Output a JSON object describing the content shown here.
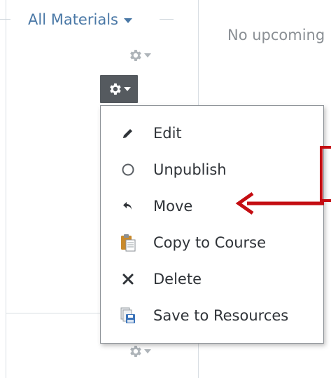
{
  "filter": {
    "label": "All Materials"
  },
  "upcoming": {
    "text": "No upcoming"
  },
  "gear_menu": {
    "items": [
      {
        "label": "Edit",
        "icon": "pencil-icon"
      },
      {
        "label": "Unpublish",
        "icon": "circle-outline-icon"
      },
      {
        "label": "Move",
        "icon": "move-arrow-icon"
      },
      {
        "label": "Copy to Course",
        "icon": "clipboard-icon"
      },
      {
        "label": "Delete",
        "icon": "x-icon"
      },
      {
        "label": "Save to Resources",
        "icon": "save-resources-icon"
      }
    ]
  },
  "colors": {
    "link_blue": "#4a78a6",
    "active_gear_bg": "#555a5f",
    "annotation_red": "#c40d12"
  }
}
